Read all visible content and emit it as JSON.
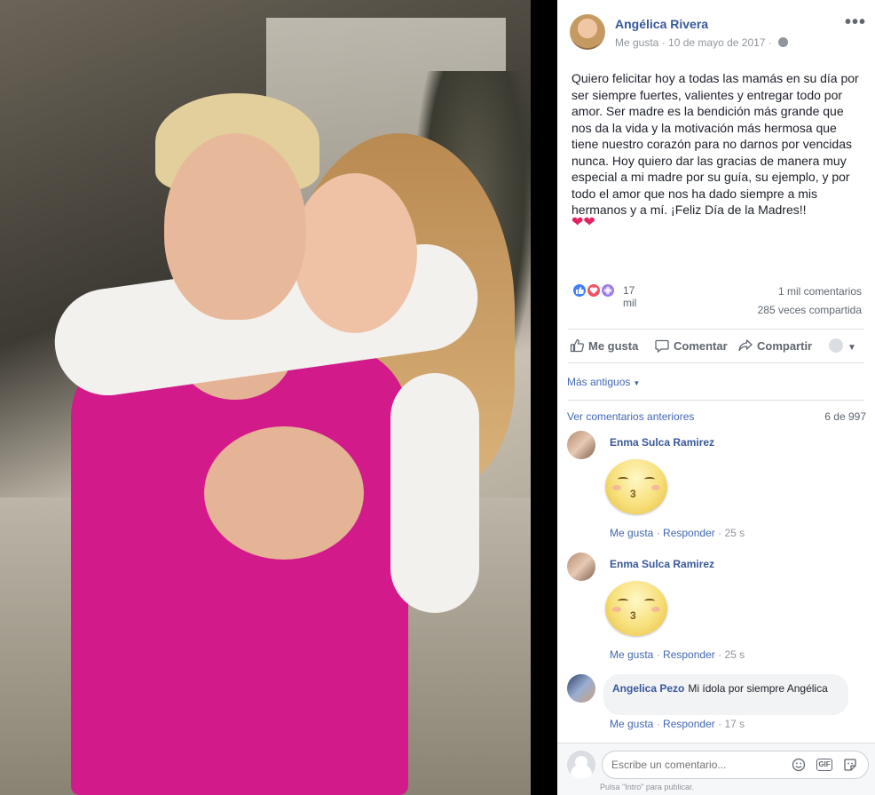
{
  "photo": {
    "alt_icon": "photo-two-women-embracing"
  },
  "post": {
    "author": "Angélica Rivera",
    "meta_like": "Me gusta",
    "meta_date": "10 de mayo de 2017",
    "meta_sep": "·",
    "privacy_icon": "globe-icon",
    "more_label": "•••",
    "text": "Quiero felicitar hoy a todas las mamás en su día por ser siempre fuertes, valientes y entregar todo por amor. Ser madre es la bendición más grande que nos da la vida y la motivación más hermosa que tiene nuestro corazón para no darnos por vencidas nunca. Hoy quiero dar las gracias de manera muy especial a mi madre por su guía, su ejemplo, y por todo el amor que nos ha dado siempre a mis hermanos y a mí. ¡Feliz Día de la Madres!!",
    "emoji": "❤❤"
  },
  "stats": {
    "reactions_count": "17 mil",
    "comments": "1 mil comentarios",
    "shares": "285 veces compartida"
  },
  "actions": {
    "like": "Me gusta",
    "comment": "Comentar",
    "share": "Compartir"
  },
  "sort": {
    "label": "Más antiguos"
  },
  "previous": {
    "label": "Ver comentarios anteriores",
    "count": "6 de 997"
  },
  "comments": [
    {
      "name": "Enma Sulca Ramirez",
      "like": "Me gusta",
      "reply": "Responder",
      "sep": "·",
      "time": "25 s"
    },
    {
      "name": "Enma Sulca Ramirez",
      "like": "Me gusta",
      "reply": "Responder",
      "sep": "·",
      "time": "25 s"
    },
    {
      "name": "Angelica Pezo",
      "text": "Mi ídola por siempre Angélica",
      "like": "Me gusta",
      "reply": "Responder",
      "sep": "·",
      "time": "17 s"
    }
  ],
  "composer": {
    "placeholder": "Escribe un comentario...",
    "hint": "Pulsa \"Intro\" para publicar.",
    "gif_label": "GIF"
  },
  "colors": {
    "link": "#385898",
    "accent": "#4267b2",
    "muted": "#90949c",
    "dress": "#d21a8a"
  }
}
